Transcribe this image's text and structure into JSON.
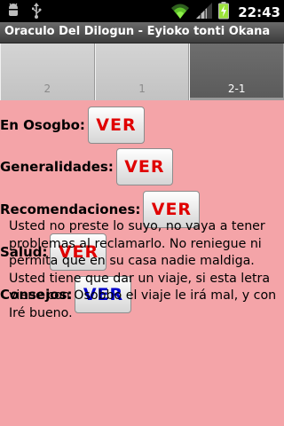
{
  "status_bar": {
    "time": "22:43",
    "icons": [
      "android-debug-icon",
      "usb-icon",
      "wifi-icon",
      "signal-icon",
      "battery-charging-icon"
    ]
  },
  "app": {
    "title": "Oraculo Del Dilogun - Eyioko tonti Okana"
  },
  "tabs": [
    {
      "label": "2",
      "selected": false
    },
    {
      "label": "1",
      "selected": false
    },
    {
      "label": "2-1",
      "selected": true
    }
  ],
  "sections": [
    {
      "label": "En Osogbo:",
      "button": "VER",
      "button_color": "#e00000"
    },
    {
      "label": "Generalidades:",
      "button": "VER",
      "button_color": "#e00000"
    },
    {
      "label": "Recomendaciones:",
      "button": "VER",
      "button_color": "#e00000"
    },
    {
      "label": "Salud:",
      "button": "VER",
      "button_color": "#e00000"
    },
    {
      "label": "Consejos:",
      "button": "VER",
      "button_color": "#0000cc"
    }
  ],
  "body_text": "Usted no preste lo suyo, no vaya a tener problemas al reclamarlo. No reniegue ni permita que en su casa nadie maldiga. Usted tiene que dar un viaje, si esta letra viene con Osobbo el viaje le irá mal, y con Iré bueno.",
  "colors": {
    "background": "#f4a4a8",
    "button_text_red": "#e00000",
    "button_text_blue": "#0000cc"
  }
}
